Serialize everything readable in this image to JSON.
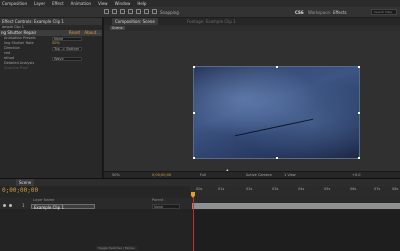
{
  "menubar": {
    "items": [
      "Composition",
      "Layer",
      "Effect",
      "Animation",
      "View",
      "Window",
      "Help"
    ]
  },
  "toolbar": {
    "snapping_label": "Snapping",
    "workspace_prefix": "CS6",
    "workspaces_label": "Workspace:",
    "workspace_value": "Effects",
    "search_placeholder": "Search Help"
  },
  "left_panel": {
    "tab_label": "Effect Controls: Example Clip 1",
    "subtitle": "ample Clip 1",
    "effect_name": "ng Shutter Repair",
    "effect_reset": "Reset",
    "effect_about": "About...",
    "properties": [
      {
        "key": "Animation Presets",
        "value": "None",
        "style": "box"
      },
      {
        "key": "ling Shutter Rate",
        "value": "50%",
        "style": "num"
      },
      {
        "key": "Direction",
        "value": "Top -> Bottom",
        "style": "box"
      },
      {
        "key": "ced",
        "value": "",
        "style": "num"
      },
      {
        "key": "ethod",
        "value": "Wave",
        "style": "box"
      },
      {
        "key": "Detailed Analysis",
        "value": "",
        "style": "num"
      },
      {
        "key": "Scanline Pixel",
        "value": "",
        "style": "faded"
      }
    ]
  },
  "viewer": {
    "tab_active": "Composition: Scene",
    "tab_inactive": "Footage: Example Clip 1",
    "breadcrumb": "Scene",
    "status": {
      "zoom": "50%",
      "timecode": "0;00;00;00",
      "resolution": "Full",
      "camera": "Active Camera",
      "views": "1 View",
      "exposure": "+0.0"
    }
  },
  "timeline": {
    "tab_label": "Scene",
    "timecode": "0;00;00;00",
    "ruler_ticks": [
      "00s",
      "01s",
      "02s",
      "03s",
      "04s",
      "05s",
      "06s",
      "07s",
      "08s"
    ],
    "columns": {
      "layer_name": "Layer Name",
      "parent": "Parent"
    },
    "layer": {
      "number": "1",
      "name": "Example Clip 1",
      "parent": "None"
    },
    "footer": "Toggle Switches / Modes"
  },
  "colors": {
    "accent": "#d4a13a",
    "playhead": "#d12b2b",
    "layer_bar": "#8d9191"
  }
}
